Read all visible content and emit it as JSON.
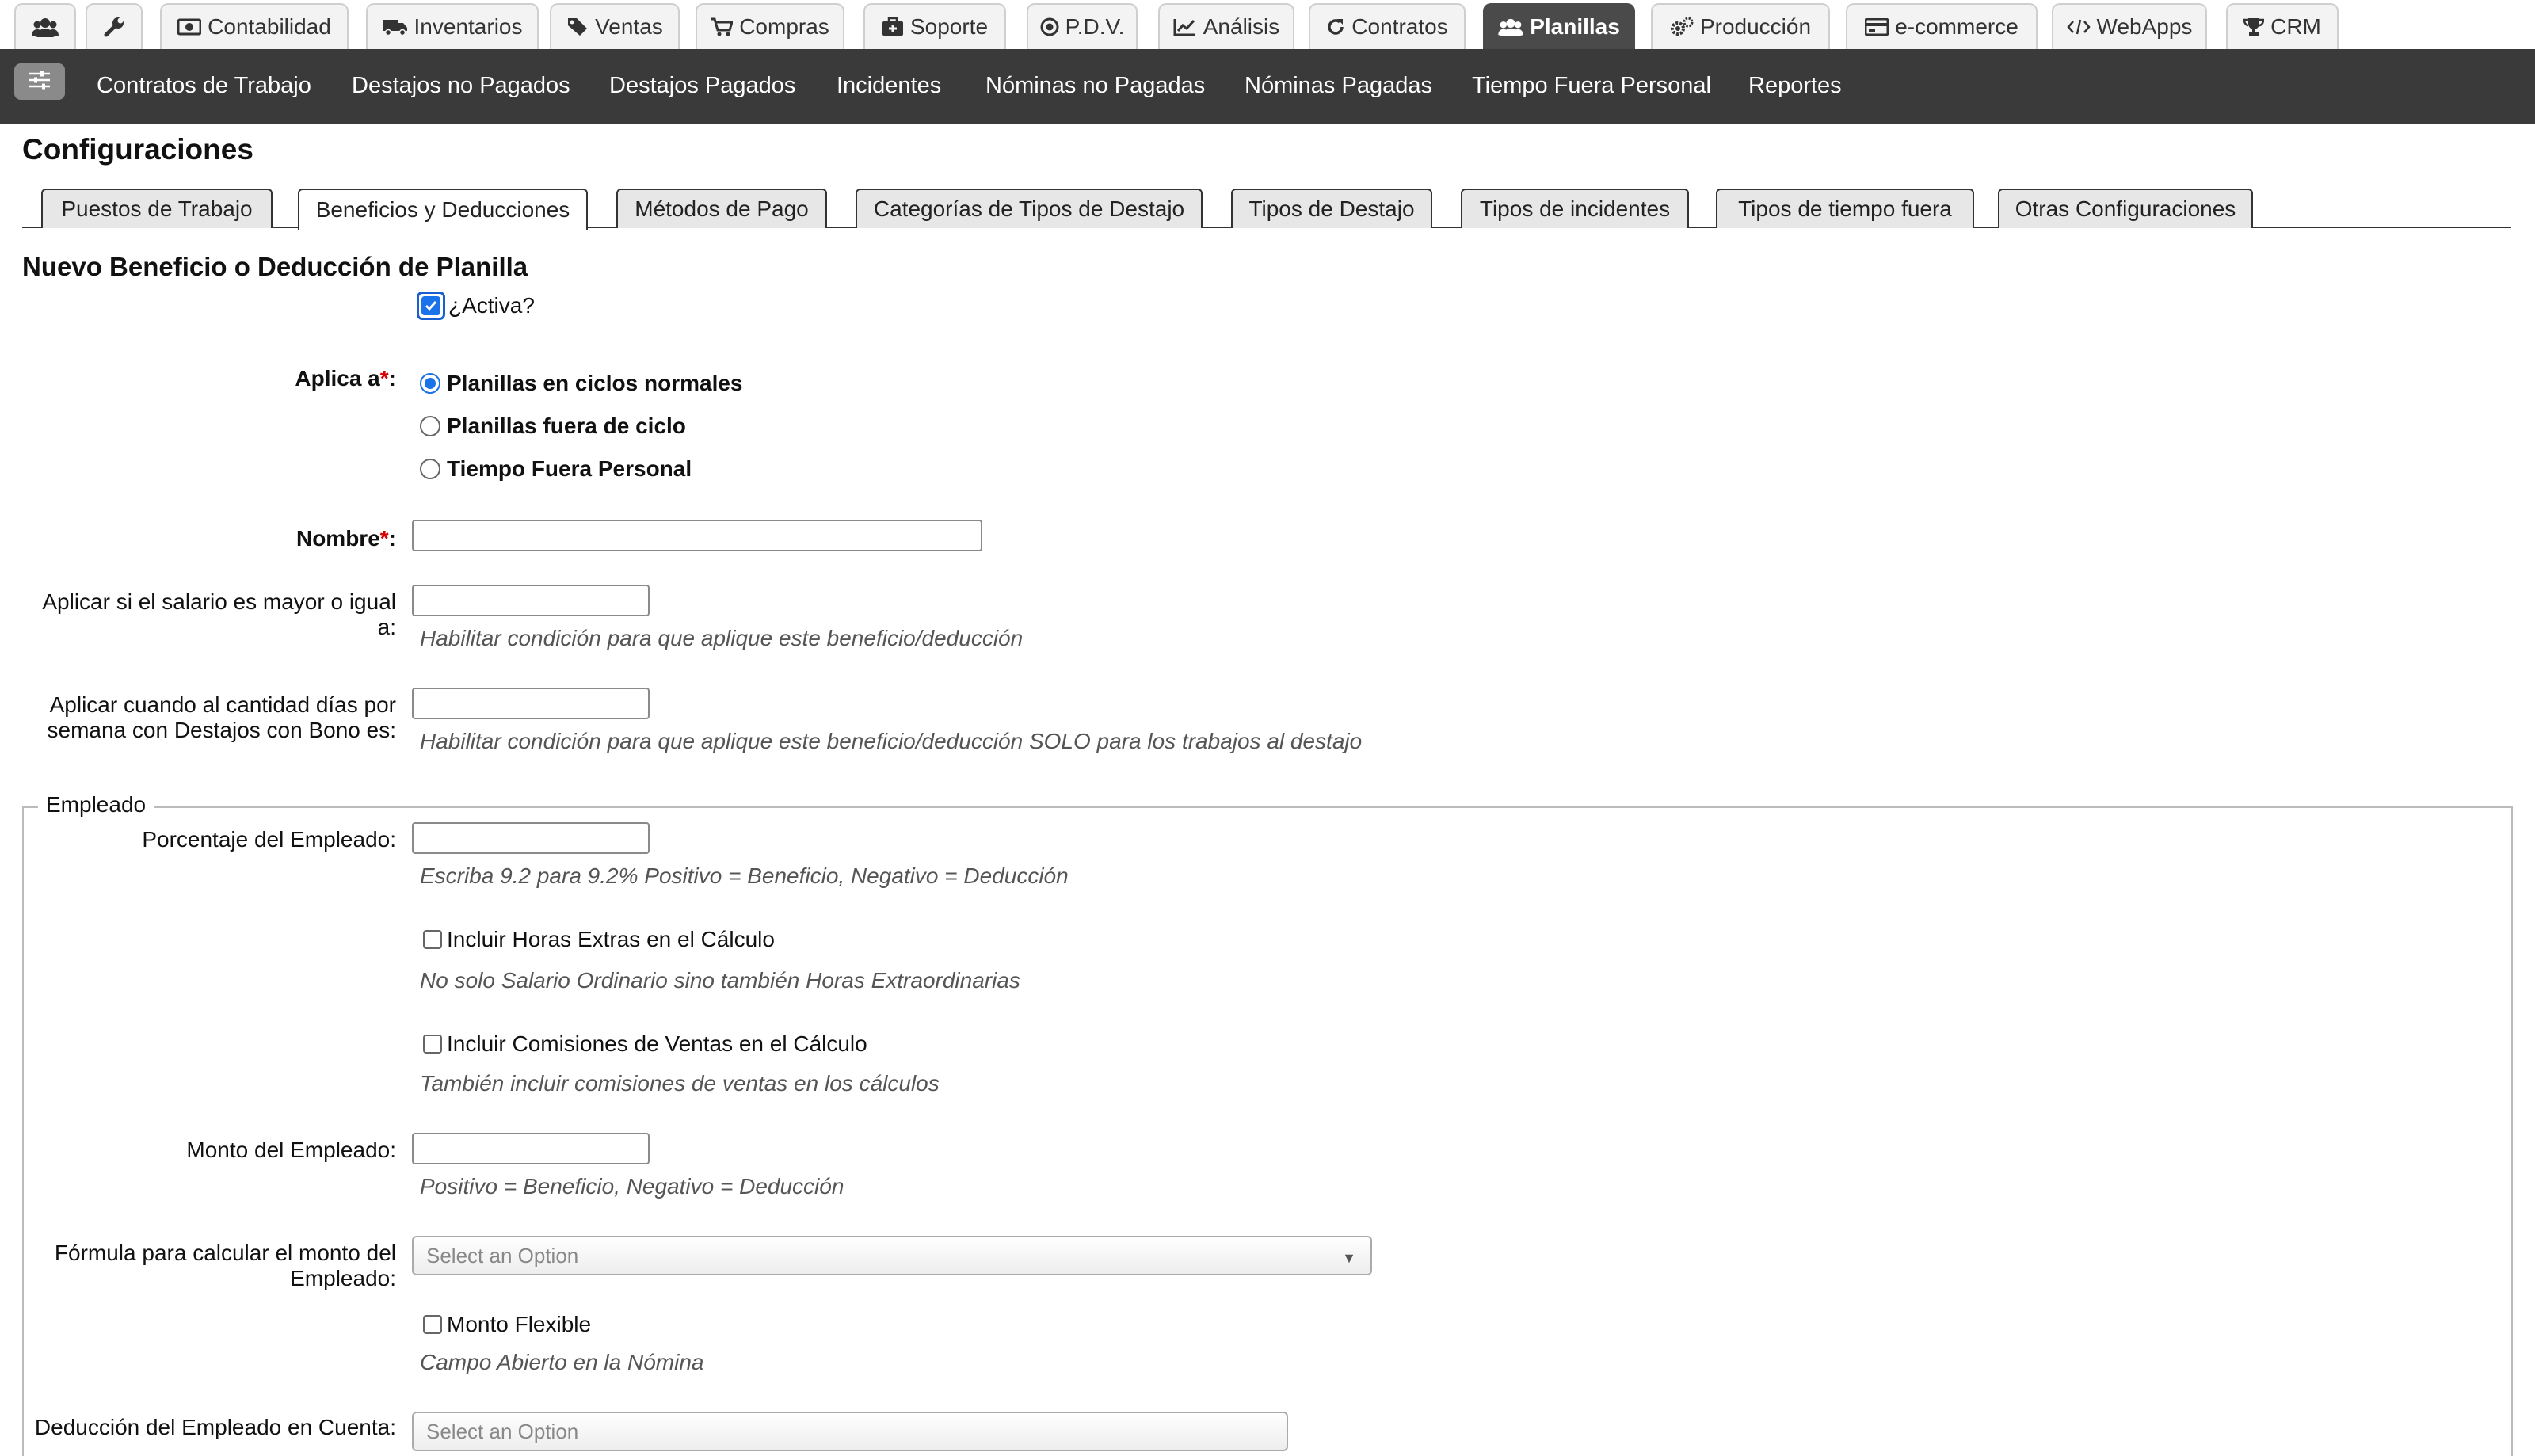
{
  "module_tabs": [
    {
      "label": "",
      "icon": "users-icon"
    },
    {
      "label": "",
      "icon": "wrench-icon"
    },
    {
      "label": "Contabilidad",
      "icon": "money-icon"
    },
    {
      "label": "Inventarios",
      "icon": "truck-icon"
    },
    {
      "label": "Ventas",
      "icon": "tag-icon"
    },
    {
      "label": "Compras",
      "icon": "cart-icon"
    },
    {
      "label": "Soporte",
      "icon": "medkit-icon"
    },
    {
      "label": "P.D.V.",
      "icon": "dot-circle-icon"
    },
    {
      "label": "Análisis",
      "icon": "chart-line-icon"
    },
    {
      "label": "Contratos",
      "icon": "refresh-icon"
    },
    {
      "label": "Planillas",
      "icon": "users-icon",
      "active": true
    },
    {
      "label": "Producción",
      "icon": "gears-icon"
    },
    {
      "label": "e-commerce",
      "icon": "credit-card-icon"
    },
    {
      "label": "WebApps",
      "icon": "code-icon"
    },
    {
      "label": "CRM",
      "icon": "trophy-icon"
    }
  ],
  "subnav": {
    "items": [
      "Contratos de Trabajo",
      "Destajos no Pagados",
      "Destajos Pagados",
      "Incidentes",
      "Nóminas no Pagadas",
      "Nóminas Pagadas",
      "Tiempo Fuera Personal",
      "Reportes"
    ]
  },
  "page": {
    "title": "Configuraciones",
    "tabs": [
      "Puestos de Trabajo",
      "Beneficios y Deducciones",
      "Métodos de Pago",
      "Categorías de Tipos de Destajo",
      "Tipos de Destajo",
      "Tipos de incidentes",
      "Tipos de tiempo fuera",
      "Otras Configuraciones"
    ],
    "active_tab": "Beneficios y Deducciones"
  },
  "form": {
    "title": "Nuevo Beneficio o Deducción de Planilla",
    "activa": {
      "label": "¿Activa?",
      "checked": true
    },
    "aplica_a": {
      "label": "Aplica a",
      "required_mark": "*",
      "suffix": ":",
      "options": [
        {
          "label": "Planillas en ciclos normales",
          "checked": true
        },
        {
          "label": "Planillas fuera de ciclo",
          "checked": false
        },
        {
          "label": "Tiempo Fuera Personal",
          "checked": false
        }
      ]
    },
    "nombre": {
      "label": "Nombre",
      "required_mark": "*",
      "suffix": ":",
      "value": ""
    },
    "salario_min": {
      "label_line1": "Aplicar si el salario es mayor o igual",
      "label_line2": "a:",
      "value": "",
      "hint": "Habilitar condición para que aplique este beneficio/deducción"
    },
    "dias_destajo": {
      "label_line1": "Aplicar cuando al cantidad días por",
      "label_line2": "semana con Destajos con Bono es:",
      "value": "",
      "hint": "Habilitar condición para que aplique este beneficio/deducción SOLO para los trabajos al destajo"
    },
    "empleado": {
      "legend": "Empleado",
      "porcentaje": {
        "label": "Porcentaje del Empleado:",
        "value": "",
        "hint": "Escriba 9.2 para 9.2% Positivo = Beneficio, Negativo = Deducción"
      },
      "horas_extras": {
        "label": "Incluir Horas Extras en el Cálculo",
        "checked": false,
        "hint": "No solo Salario Ordinario sino también Horas Extraordinarias"
      },
      "comisiones": {
        "label": "Incluir Comisiones de Ventas en el Cálculo",
        "checked": false,
        "hint": "También incluir comisiones de ventas en los cálculos"
      },
      "monto": {
        "label": "Monto del Empleado:",
        "value": "",
        "hint": "Positivo = Beneficio, Negativo = Deducción"
      },
      "formula": {
        "label_line1": "Fórmula para calcular el monto del",
        "label_line2": "Empleado:",
        "placeholder": "Select an Option"
      },
      "monto_flexible": {
        "label": "Monto Flexible",
        "checked": false,
        "hint": "Campo Abierto en la Nómina"
      },
      "cuenta_deduccion": {
        "label": "Deducción del Empleado en Cuenta:",
        "placeholder": "Select an Option"
      }
    }
  },
  "colors": {
    "active_tab_bg": "#4a4a4a",
    "subnav_bg": "#3a3a3a",
    "accent": "#1a73e8",
    "required": "#d60000"
  }
}
